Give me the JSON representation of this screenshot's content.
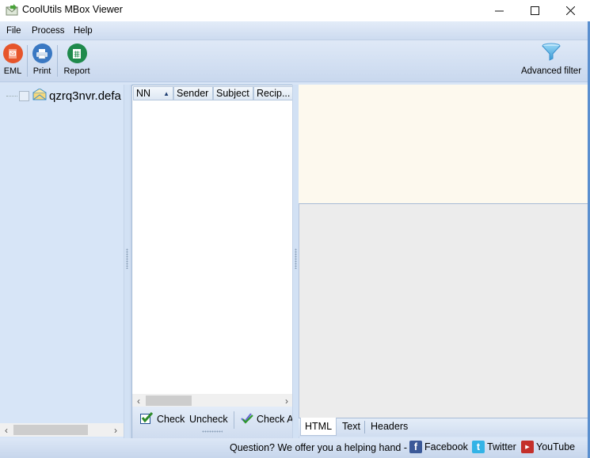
{
  "window": {
    "title": "CoolUtils MBox Viewer",
    "controls": {
      "minimize": "—",
      "maximize": "☐",
      "close": "✕"
    }
  },
  "menu": [
    "File",
    "Process",
    "Help"
  ],
  "toolbar": {
    "buttons": [
      {
        "label": "EML",
        "icon": "eml-icon",
        "color": "#e6552b"
      },
      {
        "label": "Print",
        "icon": "printer-icon",
        "color": "#3a78c2"
      },
      {
        "label": "Report",
        "icon": "report-icon",
        "color": "#1f8a4c"
      }
    ],
    "advanced_filter": {
      "label": "Advanced filter",
      "icon": "funnel-icon",
      "color": "#5aaee0"
    }
  },
  "tree": {
    "items": [
      {
        "label": "qzrq3nvr.defa",
        "checked": false
      }
    ]
  },
  "message_list": {
    "columns": [
      {
        "label": "NN",
        "sorted": "ascending"
      },
      {
        "label": "Sender"
      },
      {
        "label": "Subject"
      },
      {
        "label": "Recip..."
      }
    ],
    "rows": [],
    "actions": {
      "check": "Check",
      "uncheck": "Uncheck",
      "check_all": "Check A"
    }
  },
  "preview": {
    "tabs": [
      {
        "label": "HTML",
        "active": true
      },
      {
        "label": "Text",
        "active": false
      },
      {
        "label": "Headers",
        "active": false
      }
    ]
  },
  "status": {
    "question": "Question? We offer you a helping hand -",
    "links": [
      {
        "label": "Facebook",
        "icon": "facebook-icon",
        "color": "#3b5998"
      },
      {
        "label": "Twitter",
        "icon": "twitter-icon",
        "color": "#33b3e6"
      },
      {
        "label": "YouTube",
        "icon": "youtube-icon",
        "color": "#c4302b"
      }
    ]
  }
}
